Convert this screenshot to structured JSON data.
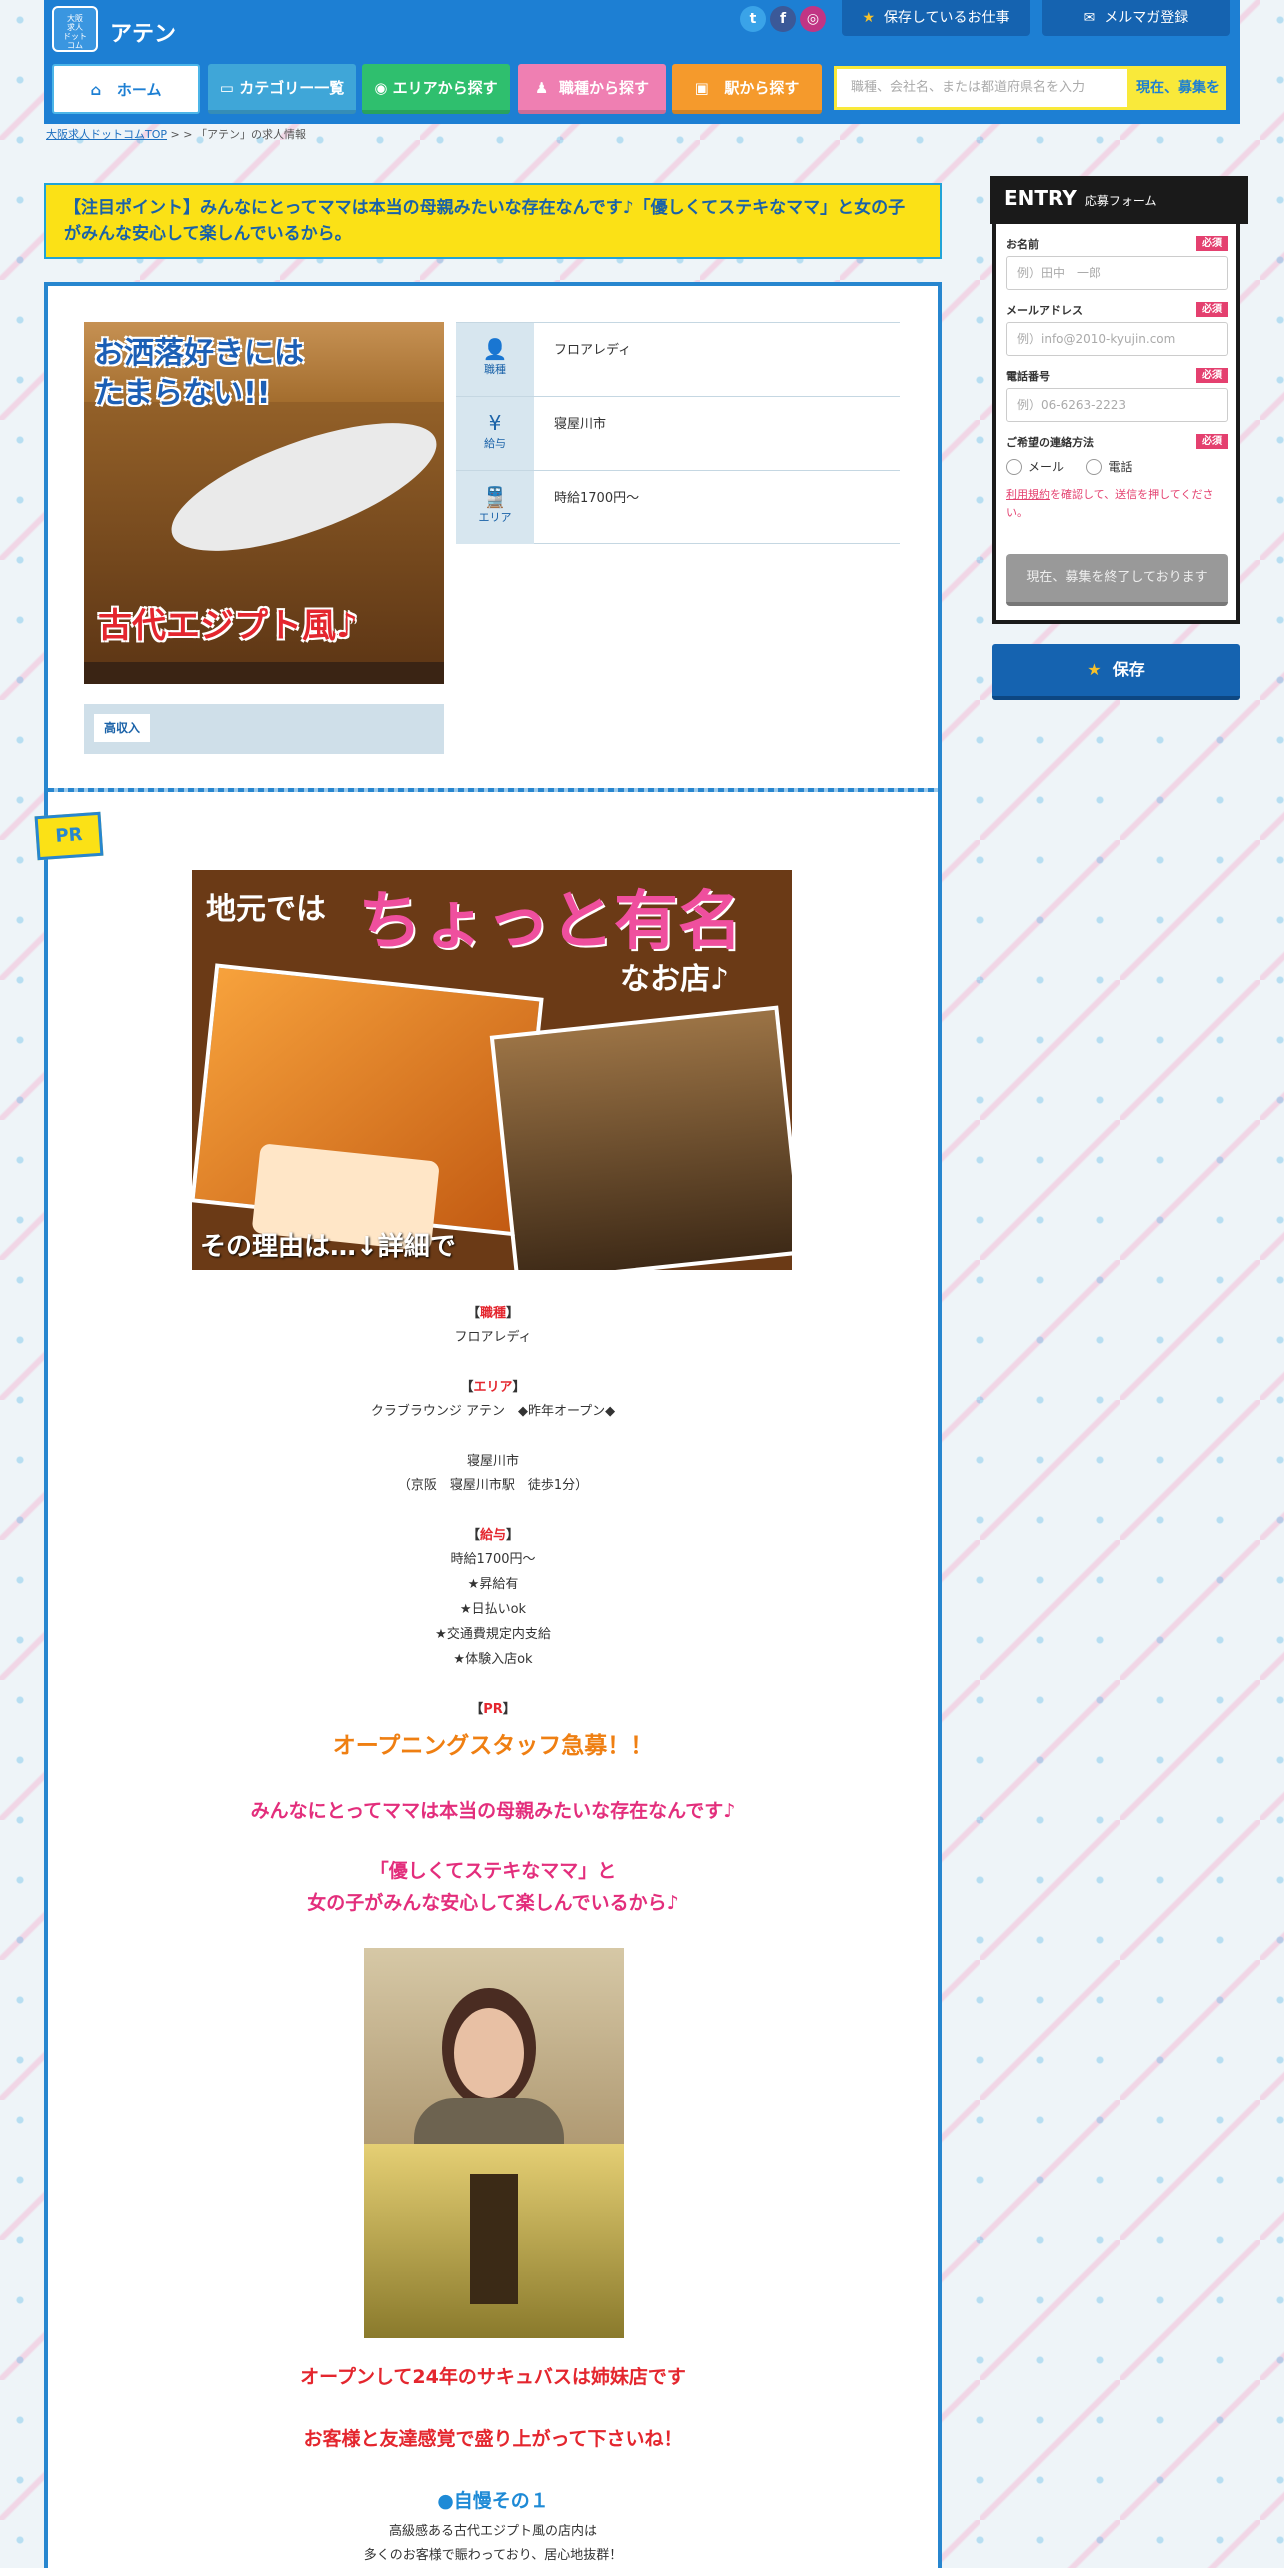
{
  "header": {
    "logo_text": "大阪\n求人\nドット\nコム",
    "site_title": "アテン",
    "social": [
      "t",
      "f",
      "◎"
    ],
    "saved_jobs_label": "保存しているお仕事",
    "newsletter_label": "メルマガ登録"
  },
  "nav": [
    {
      "label": "ホーム",
      "color": "#4cb5e8",
      "icon": "home-icon"
    },
    {
      "label": "カテゴリー一覧",
      "color": "#3fa6d8",
      "icon": "folder-icon"
    },
    {
      "label": "エリアから探す",
      "color": "#2fbf6e",
      "icon": "pin-icon"
    },
    {
      "label": "職種から探す",
      "color": "#ef7fb2",
      "icon": "person-icon"
    },
    {
      "label": "駅から探す",
      "color": "#f59a2c",
      "icon": "train-icon"
    }
  ],
  "search": {
    "placeholder": "職種、会社名、または都道府県名を入力",
    "button": "現在、募集を"
  },
  "breadcrumb": {
    "home": "大阪求人ドットコムTOP",
    "sep1": " > ",
    "sep2": " > ",
    "current": "「アテン」の求人情報"
  },
  "highlight": "【注目ポイント】みんなにとってママは本当の母親みたいな存在なんです♪「優しくてステキなママ」と女の子がみんな安心して楽しんでいるから。",
  "photo1": {
    "caption_top": "お洒落好きには\nたまらない!!",
    "caption_bottom": "古代エジプト風♪"
  },
  "tags": [
    "高収入"
  ],
  "info": [
    {
      "icon": "👤",
      "label": "職種",
      "value": "フロアレディ"
    },
    {
      "icon": "¥",
      "label": "給与",
      "value": "寝屋川市"
    },
    {
      "icon": "🚆",
      "label": "エリア",
      "value": "時給1700円～"
    }
  ],
  "pr_badge": "PR",
  "banner": {
    "text1": "地元では",
    "text2": "ちょっと有名",
    "text3": "なお店♪",
    "text4": "その理由は…↓詳細で"
  },
  "details": {
    "job_head": "職種",
    "job_val": "フロアレディ",
    "area_head": "エリア",
    "area_val1": "クラブラウンジ アテン　◆昨年オープン◆",
    "area_val2": "寝屋川市",
    "area_val3": "（京阪　寝屋川市駅　徒歩1分）",
    "salary_head": "給与",
    "salary_lines": [
      "時給1700円～",
      "★昇給有",
      "★日払いok",
      "★交通費規定内支給",
      "★体験入店ok"
    ],
    "pr_head": "PR",
    "pr_title": "オープニングスタッフ急募！！",
    "pink1": "みんなにとってママは本当の母親みたいな存在なんです♪",
    "pink2": "「優しくてステキなママ」と",
    "pink3": "女の子がみんな安心して楽しんでいるから♪",
    "red1": "オープンして24年のサキュバスは姉妹店です",
    "red2": "お客様と友達感覚で盛り上がって下さいね！",
    "blue1": "●自慢その１",
    "last1": "高級感ある古代エジプト風の店内は",
    "last2": "多くのお客様で賑わっており、居心地抜群！"
  },
  "entry": {
    "title": "ENTRY",
    "subtitle": "応募フォーム",
    "required": "必須",
    "name_label": "お名前",
    "name_ph": "例）田中　一郎",
    "mail_label": "メールアドレス",
    "mail_ph": "例）info@2010-kyujin.com",
    "tel_label": "電話番号",
    "tel_ph": "例）06-6263-2223",
    "contact_label": "ご希望の連絡方法",
    "opt_mail": "メール",
    "opt_tel": "電話",
    "terms_link": "利用規約",
    "terms_rest": "を確認して、送信を押してください。",
    "closed": "現在、募集を終了しております"
  },
  "save_label": "保存"
}
